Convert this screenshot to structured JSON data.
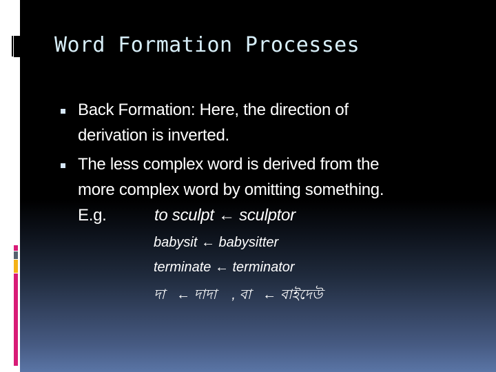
{
  "slide": {
    "title": "Word Formation Processes",
    "bullets": [
      {
        "lines": [
          "Back Formation: Here, the direction of",
          "derivation is inverted."
        ]
      },
      {
        "lines": [
          "The less complex word is derived from the",
          "more complex word by omitting something."
        ]
      }
    ],
    "example_label": "E.g.",
    "examples": [
      {
        "base": "to sculpt",
        "arrow": "←",
        "derived": "sculptor"
      },
      {
        "base": "babysit",
        "arrow": "←",
        "derived": "babysitter"
      },
      {
        "base": "terminate",
        "arrow": "←",
        "derived": "terminator"
      },
      {
        "base": "দা",
        "arrow": "←",
        "derived": "দাদা",
        "separator": ",",
        "base2": "বা",
        "arrow2": "←",
        "derived2": "বাইদেউ"
      }
    ],
    "bullet_icon": "square-bullet-icon",
    "colors": {
      "title": "#d7eef8",
      "text": "#ffffff",
      "accent_pink": "#d81b77",
      "accent_slate": "#56616f",
      "accent_orange": "#f4b218",
      "bullet": "#d6e7f8"
    }
  }
}
